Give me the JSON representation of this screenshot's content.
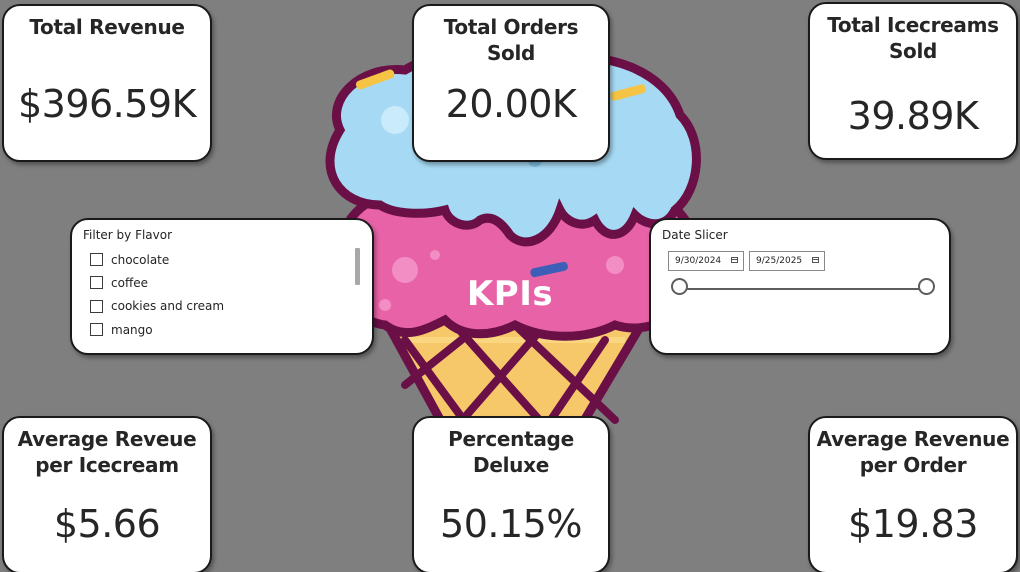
{
  "kpis": {
    "total_revenue": {
      "title": "Total Revenue",
      "value": "$396.59K"
    },
    "total_orders_sold": {
      "title": "Total Orders Sold",
      "value": "20.00K"
    },
    "total_icecreams_sold": {
      "title": "Total Icecreams Sold",
      "value": "39.89K"
    },
    "avg_revenue_per_icecream": {
      "title": "Average Reveue per Icecream",
      "value": "$5.66"
    },
    "percentage_deluxe": {
      "title": "Percentage Deluxe",
      "value": "50.15%"
    },
    "avg_revenue_per_order": {
      "title": "Average Revenue per Order",
      "value": "$19.83"
    }
  },
  "center_label": "KPIs",
  "flavor_slicer": {
    "title": "Filter by Flavor",
    "items": [
      {
        "label": "chocolate",
        "checked": false
      },
      {
        "label": "coffee",
        "checked": false
      },
      {
        "label": "cookies and cream",
        "checked": false
      },
      {
        "label": "mango",
        "checked": false
      }
    ]
  },
  "date_slicer": {
    "title": "Date Slicer",
    "start_date": "9/30/2024",
    "end_date": "9/25/2025",
    "calendar_icon": "calendar-icon"
  },
  "colors": {
    "background": "#7f7f7f",
    "card": "#ffffff",
    "scoop_blue": "#9fd6f2",
    "scoop_pink": "#e862a8",
    "cone": "#f7c86a",
    "outline": "#6b0f47"
  }
}
